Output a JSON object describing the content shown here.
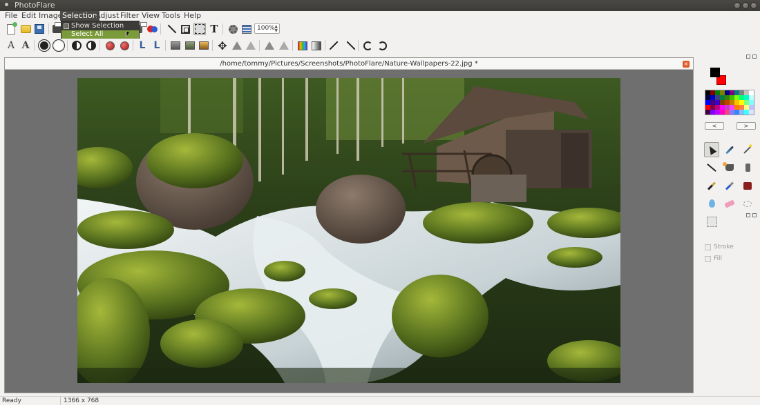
{
  "window": {
    "title": "PhotoFlare"
  },
  "menubar": {
    "items": [
      "File",
      "Edit",
      "Image",
      "Selection",
      "Adjust",
      "Filter",
      "View",
      "Tools",
      "Help"
    ],
    "active": "Selection"
  },
  "selection_menu": {
    "items": [
      {
        "label": "Show Selection",
        "has_checkbox": true,
        "highlighted": false
      },
      {
        "label": "Select All",
        "has_checkbox": false,
        "highlighted": true
      }
    ]
  },
  "toolbar": {
    "zoom_value": "100%",
    "spin_up": "▲",
    "spin_down": "▼",
    "text_tool_glyph": "T",
    "move_glyph": "✥",
    "adjust_glyphs": [
      "A",
      "A"
    ],
    "level_glyphs": [
      "L",
      "L"
    ]
  },
  "document": {
    "title": "/home/tommy/Pictures/Screenshots/PhotoFlare/Nature-Wallpapers-22.jpg *",
    "close_glyph": "×"
  },
  "colors": {
    "foreground": "#000000",
    "background": "#ff0000",
    "palette": [
      "#000000",
      "#800000",
      "#008000",
      "#808000",
      "#000080",
      "#800080",
      "#008080",
      "#808080",
      "#c0c0c0",
      "#ffffff",
      "#000040",
      "#0000c0",
      "#404080",
      "#008040",
      "#408000",
      "#40c000",
      "#80ff00",
      "#00ff80",
      "#00ffc0",
      "#c0ffff",
      "#0000ff",
      "#400080",
      "#4000c0",
      "#804000",
      "#c04000",
      "#c08000",
      "#ffc000",
      "#ffff00",
      "#80ff80",
      "#80ffff",
      "#ff0000",
      "#800040",
      "#c00080",
      "#ff00ff",
      "#c040c0",
      "#ff40ff",
      "#ff8000",
      "#ff8040",
      "#ffff80",
      "#c0c0ff",
      "#400040",
      "#8000ff",
      "#c000ff",
      "#ff00c0",
      "#ff4080",
      "#8080ff",
      "#4080ff",
      "#80c0ff",
      "#40ffff",
      "#e0e0ff"
    ],
    "prev_label": "<",
    "next_label": ">"
  },
  "options": {
    "stroke_label": "Stroke",
    "fill_label": "Fill"
  },
  "statusbar": {
    "status": "Ready",
    "dimensions": "1366 x 768"
  }
}
